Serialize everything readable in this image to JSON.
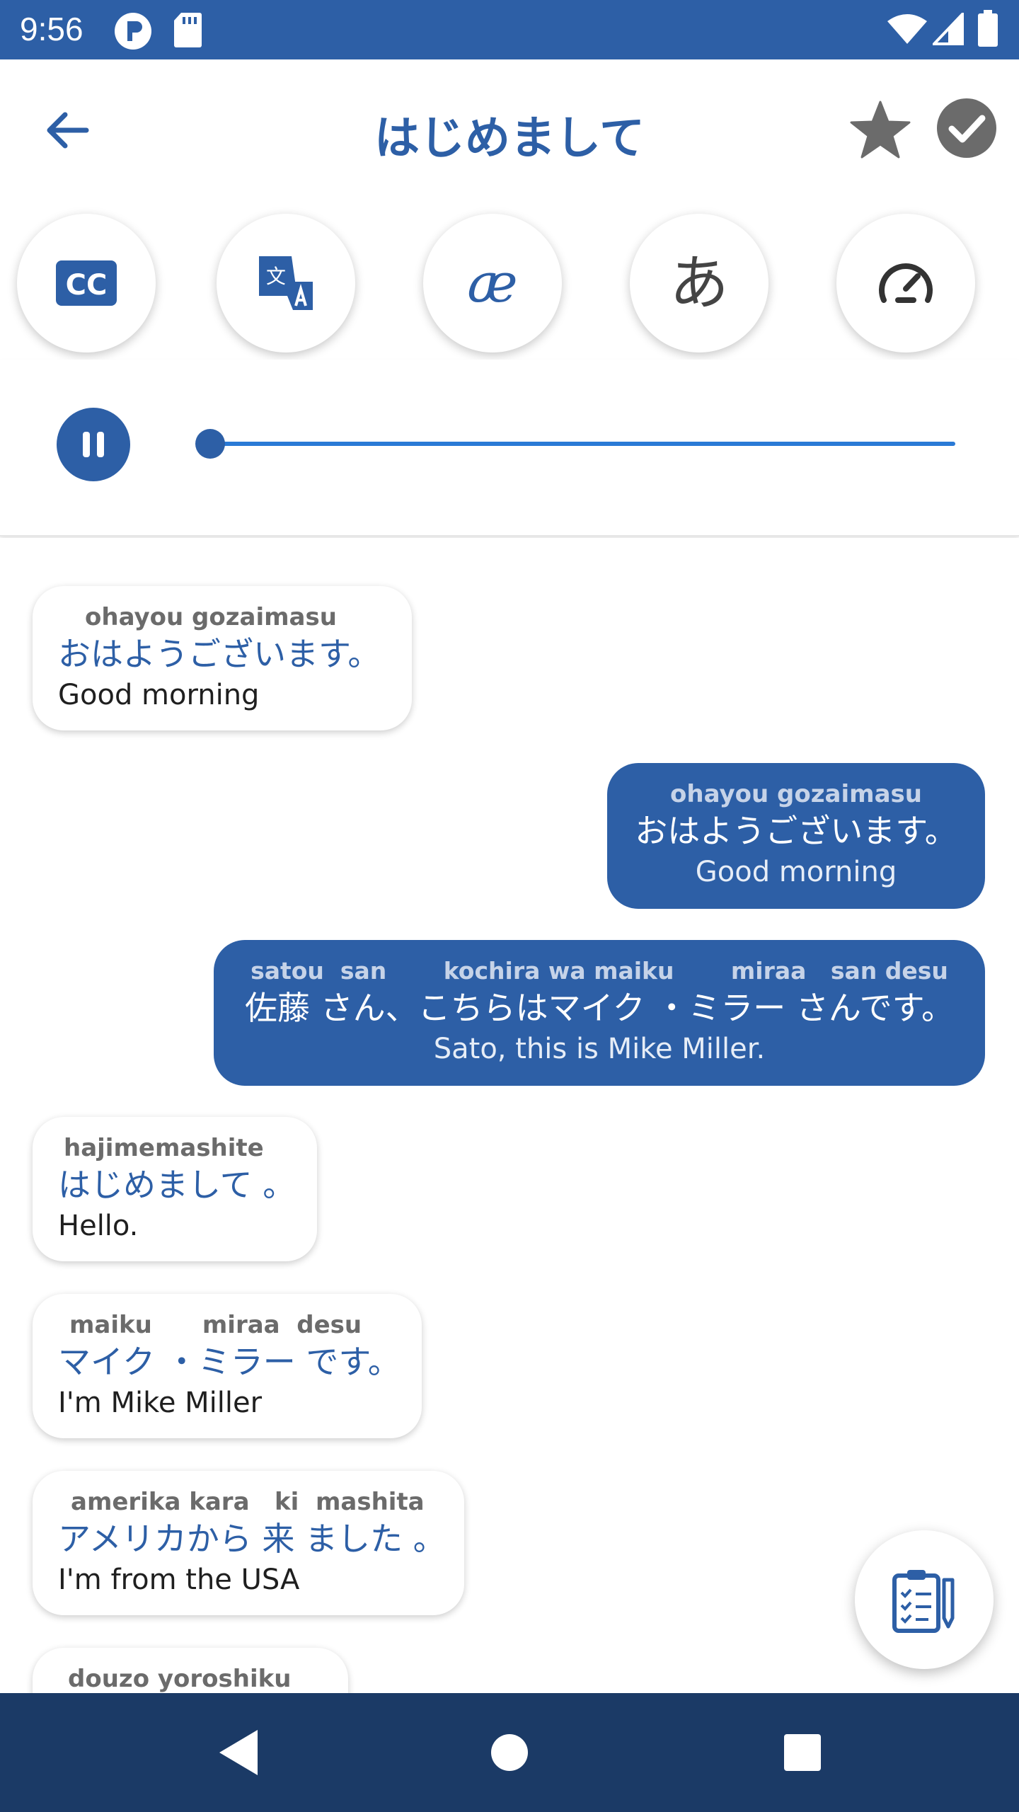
{
  "status_bar": {
    "time": "9:56",
    "icons": [
      "p-circle-icon",
      "sd-card-icon",
      "wifi-icon",
      "signal-icon",
      "battery-icon"
    ]
  },
  "header": {
    "title": "はじめまして",
    "back_icon": "arrow-left-icon",
    "star_icon": "star-icon",
    "check_icon": "check-circle-icon"
  },
  "toolbar": {
    "tools": [
      {
        "name": "closed-captions",
        "icon": "cc-icon",
        "label": "CC"
      },
      {
        "name": "translate",
        "icon": "translate-icon",
        "label": "文"
      },
      {
        "name": "phonetic",
        "icon": "ae-ligature-icon",
        "label": "æ"
      },
      {
        "name": "hiragana",
        "icon": "hiragana-a-icon",
        "label": "あ"
      },
      {
        "name": "speed",
        "icon": "speedometer-icon",
        "label": ""
      }
    ]
  },
  "player": {
    "state": "playing",
    "progress": 0.0
  },
  "colors": {
    "primary": "#2d5fa6",
    "status_bar": "#2d5fa6",
    "nav_bar": "#1b3a66",
    "track": "#2a7ad6"
  },
  "messages": [
    {
      "side": "left",
      "romaji": "ohayou gozaimasu",
      "jp": "おはようございます。",
      "en": "Good morning"
    },
    {
      "side": "right",
      "romaji": "ohayou gozaimasu",
      "jp": "おはようございます。",
      "en": "Good morning"
    },
    {
      "side": "right",
      "romaji": "satou  san       kochira wa maiku       miraa   san desu",
      "jp": "佐藤 さん、こちらはマイク ・ミラー さんです。",
      "en": "Sato, this is Mike Miller."
    },
    {
      "side": "left",
      "romaji": "hajimemashite",
      "jp": "はじめまして 。",
      "en": "Hello."
    },
    {
      "side": "left",
      "romaji": "maiku      miraa  desu",
      "jp": "マイク ・ミラー です。",
      "en": "I'm Mike Miller"
    },
    {
      "side": "left",
      "romaji": "amerika kara   ki  mashita",
      "jp": "アメリカから 来 ました 。",
      "en": "I'm from the USA"
    },
    {
      "side": "left",
      "romaji": "douzo yoroshiku",
      "jp": "",
      "en": ""
    }
  ],
  "fab": {
    "icon": "clipboard-checklist-icon"
  },
  "nav": {
    "icons": [
      "nav-back-icon",
      "nav-home-icon",
      "nav-recents-icon"
    ]
  }
}
